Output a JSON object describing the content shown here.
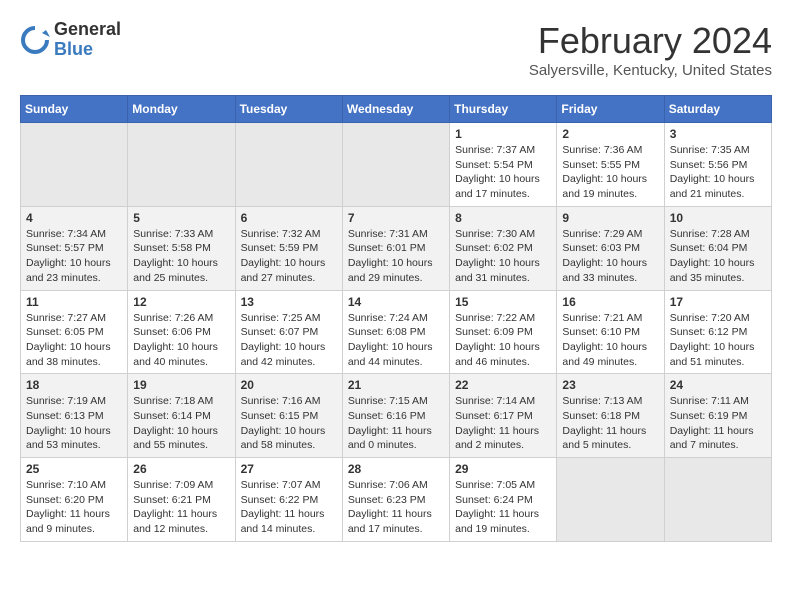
{
  "header": {
    "logo_general": "General",
    "logo_blue": "Blue",
    "month": "February 2024",
    "location": "Salyersville, Kentucky, United States"
  },
  "calendar": {
    "days_of_week": [
      "Sunday",
      "Monday",
      "Tuesday",
      "Wednesday",
      "Thursday",
      "Friday",
      "Saturday"
    ],
    "weeks": [
      [
        {
          "day": "",
          "info": ""
        },
        {
          "day": "",
          "info": ""
        },
        {
          "day": "",
          "info": ""
        },
        {
          "day": "",
          "info": ""
        },
        {
          "day": "1",
          "info": "Sunrise: 7:37 AM\nSunset: 5:54 PM\nDaylight: 10 hours\nand 17 minutes."
        },
        {
          "day": "2",
          "info": "Sunrise: 7:36 AM\nSunset: 5:55 PM\nDaylight: 10 hours\nand 19 minutes."
        },
        {
          "day": "3",
          "info": "Sunrise: 7:35 AM\nSunset: 5:56 PM\nDaylight: 10 hours\nand 21 minutes."
        }
      ],
      [
        {
          "day": "4",
          "info": "Sunrise: 7:34 AM\nSunset: 5:57 PM\nDaylight: 10 hours\nand 23 minutes."
        },
        {
          "day": "5",
          "info": "Sunrise: 7:33 AM\nSunset: 5:58 PM\nDaylight: 10 hours\nand 25 minutes."
        },
        {
          "day": "6",
          "info": "Sunrise: 7:32 AM\nSunset: 5:59 PM\nDaylight: 10 hours\nand 27 minutes."
        },
        {
          "day": "7",
          "info": "Sunrise: 7:31 AM\nSunset: 6:01 PM\nDaylight: 10 hours\nand 29 minutes."
        },
        {
          "day": "8",
          "info": "Sunrise: 7:30 AM\nSunset: 6:02 PM\nDaylight: 10 hours\nand 31 minutes."
        },
        {
          "day": "9",
          "info": "Sunrise: 7:29 AM\nSunset: 6:03 PM\nDaylight: 10 hours\nand 33 minutes."
        },
        {
          "day": "10",
          "info": "Sunrise: 7:28 AM\nSunset: 6:04 PM\nDaylight: 10 hours\nand 35 minutes."
        }
      ],
      [
        {
          "day": "11",
          "info": "Sunrise: 7:27 AM\nSunset: 6:05 PM\nDaylight: 10 hours\nand 38 minutes."
        },
        {
          "day": "12",
          "info": "Sunrise: 7:26 AM\nSunset: 6:06 PM\nDaylight: 10 hours\nand 40 minutes."
        },
        {
          "day": "13",
          "info": "Sunrise: 7:25 AM\nSunset: 6:07 PM\nDaylight: 10 hours\nand 42 minutes."
        },
        {
          "day": "14",
          "info": "Sunrise: 7:24 AM\nSunset: 6:08 PM\nDaylight: 10 hours\nand 44 minutes."
        },
        {
          "day": "15",
          "info": "Sunrise: 7:22 AM\nSunset: 6:09 PM\nDaylight: 10 hours\nand 46 minutes."
        },
        {
          "day": "16",
          "info": "Sunrise: 7:21 AM\nSunset: 6:10 PM\nDaylight: 10 hours\nand 49 minutes."
        },
        {
          "day": "17",
          "info": "Sunrise: 7:20 AM\nSunset: 6:12 PM\nDaylight: 10 hours\nand 51 minutes."
        }
      ],
      [
        {
          "day": "18",
          "info": "Sunrise: 7:19 AM\nSunset: 6:13 PM\nDaylight: 10 hours\nand 53 minutes."
        },
        {
          "day": "19",
          "info": "Sunrise: 7:18 AM\nSunset: 6:14 PM\nDaylight: 10 hours\nand 55 minutes."
        },
        {
          "day": "20",
          "info": "Sunrise: 7:16 AM\nSunset: 6:15 PM\nDaylight: 10 hours\nand 58 minutes."
        },
        {
          "day": "21",
          "info": "Sunrise: 7:15 AM\nSunset: 6:16 PM\nDaylight: 11 hours\nand 0 minutes."
        },
        {
          "day": "22",
          "info": "Sunrise: 7:14 AM\nSunset: 6:17 PM\nDaylight: 11 hours\nand 2 minutes."
        },
        {
          "day": "23",
          "info": "Sunrise: 7:13 AM\nSunset: 6:18 PM\nDaylight: 11 hours\nand 5 minutes."
        },
        {
          "day": "24",
          "info": "Sunrise: 7:11 AM\nSunset: 6:19 PM\nDaylight: 11 hours\nand 7 minutes."
        }
      ],
      [
        {
          "day": "25",
          "info": "Sunrise: 7:10 AM\nSunset: 6:20 PM\nDaylight: 11 hours\nand 9 minutes."
        },
        {
          "day": "26",
          "info": "Sunrise: 7:09 AM\nSunset: 6:21 PM\nDaylight: 11 hours\nand 12 minutes."
        },
        {
          "day": "27",
          "info": "Sunrise: 7:07 AM\nSunset: 6:22 PM\nDaylight: 11 hours\nand 14 minutes."
        },
        {
          "day": "28",
          "info": "Sunrise: 7:06 AM\nSunset: 6:23 PM\nDaylight: 11 hours\nand 17 minutes."
        },
        {
          "day": "29",
          "info": "Sunrise: 7:05 AM\nSunset: 6:24 PM\nDaylight: 11 hours\nand 19 minutes."
        },
        {
          "day": "",
          "info": ""
        },
        {
          "day": "",
          "info": ""
        }
      ]
    ]
  }
}
